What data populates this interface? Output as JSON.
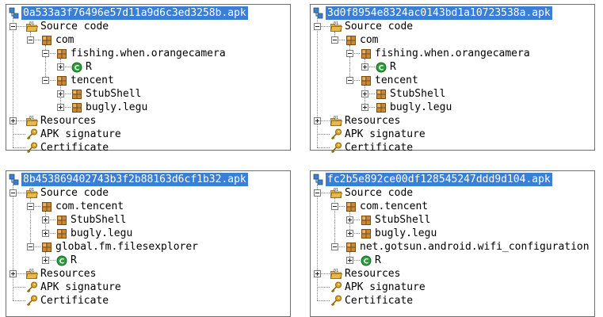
{
  "panels": [
    {
      "title": "0a533a3f76496e57d11a9d6c3ed3258b.apk",
      "rows": [
        {
          "label": "Source code",
          "icon": "folder-source-icon",
          "level": 1,
          "toggle": "minus"
        },
        {
          "label": "com",
          "icon": "package-icon",
          "level": 2,
          "toggle": "minus"
        },
        {
          "label": "fishing.when.orangecamera",
          "icon": "package-icon",
          "level": 3,
          "toggle": "minus"
        },
        {
          "label": "R",
          "icon": "class-icon",
          "level": 4,
          "toggle": "plus"
        },
        {
          "label": "tencent",
          "icon": "package-icon",
          "level": 3,
          "toggle": "minus"
        },
        {
          "label": "StubShell",
          "icon": "package-icon",
          "level": 4,
          "toggle": "plus"
        },
        {
          "label": "bugly.legu",
          "icon": "package-icon",
          "level": 4,
          "toggle": "plus"
        },
        {
          "label": "Resources",
          "icon": "folder-resources-icon",
          "level": 1,
          "toggle": "plus"
        },
        {
          "label": "APK signature",
          "icon": "key-icon",
          "level": 1,
          "toggle": "none"
        },
        {
          "label": "Certificate",
          "icon": "key-icon",
          "level": 1,
          "toggle": "none"
        }
      ]
    },
    {
      "title": "3d0f8954e8324ac0143bd1a10723538a.apk",
      "rows": [
        {
          "label": "Source code",
          "icon": "folder-source-icon",
          "level": 1,
          "toggle": "minus"
        },
        {
          "label": "com",
          "icon": "package-icon",
          "level": 2,
          "toggle": "minus"
        },
        {
          "label": "fishing.when.orangecamera",
          "icon": "package-icon",
          "level": 3,
          "toggle": "minus"
        },
        {
          "label": "R",
          "icon": "class-icon",
          "level": 4,
          "toggle": "plus"
        },
        {
          "label": "tencent",
          "icon": "package-icon",
          "level": 3,
          "toggle": "minus"
        },
        {
          "label": "StubShell",
          "icon": "package-icon",
          "level": 4,
          "toggle": "plus"
        },
        {
          "label": "bugly.legu",
          "icon": "package-icon",
          "level": 4,
          "toggle": "plus"
        },
        {
          "label": "Resources",
          "icon": "folder-resources-icon",
          "level": 1,
          "toggle": "plus"
        },
        {
          "label": "APK signature",
          "icon": "key-icon",
          "level": 1,
          "toggle": "none"
        },
        {
          "label": "Certificate",
          "icon": "key-icon",
          "level": 1,
          "toggle": "none"
        }
      ]
    },
    {
      "title": "8b453869402743b3f2b88163d6cf1b32.apk",
      "rows": [
        {
          "label": "Source code",
          "icon": "folder-source-icon",
          "level": 1,
          "toggle": "minus"
        },
        {
          "label": "com.tencent",
          "icon": "package-icon",
          "level": 2,
          "toggle": "minus"
        },
        {
          "label": "StubShell",
          "icon": "package-icon",
          "level": 3,
          "toggle": "plus"
        },
        {
          "label": "bugly.legu",
          "icon": "package-icon",
          "level": 3,
          "toggle": "plus"
        },
        {
          "label": "global.fm.filesexplorer",
          "icon": "package-icon",
          "level": 2,
          "toggle": "minus"
        },
        {
          "label": "R",
          "icon": "class-icon",
          "level": 3,
          "toggle": "plus"
        },
        {
          "label": "Resources",
          "icon": "folder-resources-icon",
          "level": 1,
          "toggle": "plus"
        },
        {
          "label": "APK signature",
          "icon": "key-icon",
          "level": 1,
          "toggle": "none"
        },
        {
          "label": "Certificate",
          "icon": "key-icon",
          "level": 1,
          "toggle": "none"
        }
      ]
    },
    {
      "title": "fc2b5e892ce00df128545247ddd9d104.apk",
      "rows": [
        {
          "label": "Source code",
          "icon": "folder-source-icon",
          "level": 1,
          "toggle": "minus"
        },
        {
          "label": "com.tencent",
          "icon": "package-icon",
          "level": 2,
          "toggle": "minus"
        },
        {
          "label": "StubShell",
          "icon": "package-icon",
          "level": 3,
          "toggle": "plus"
        },
        {
          "label": "bugly.legu",
          "icon": "package-icon",
          "level": 3,
          "toggle": "plus"
        },
        {
          "label": "net.gotsun.android.wifi_configuration",
          "icon": "package-icon",
          "level": 2,
          "toggle": "minus"
        },
        {
          "label": "R",
          "icon": "class-icon",
          "level": 3,
          "toggle": "plus"
        },
        {
          "label": "Resources",
          "icon": "folder-resources-icon",
          "level": 1,
          "toggle": "plus"
        },
        {
          "label": "APK signature",
          "icon": "key-icon",
          "level": 1,
          "toggle": "none"
        },
        {
          "label": "Certificate",
          "icon": "key-icon",
          "level": 1,
          "toggle": "none"
        }
      ]
    }
  ],
  "colors": {
    "selection": "#3a7fd6",
    "package": "#c88a3a",
    "class": "#2e9b3c",
    "folder": "#e8b84a",
    "key": "#d9a521"
  }
}
